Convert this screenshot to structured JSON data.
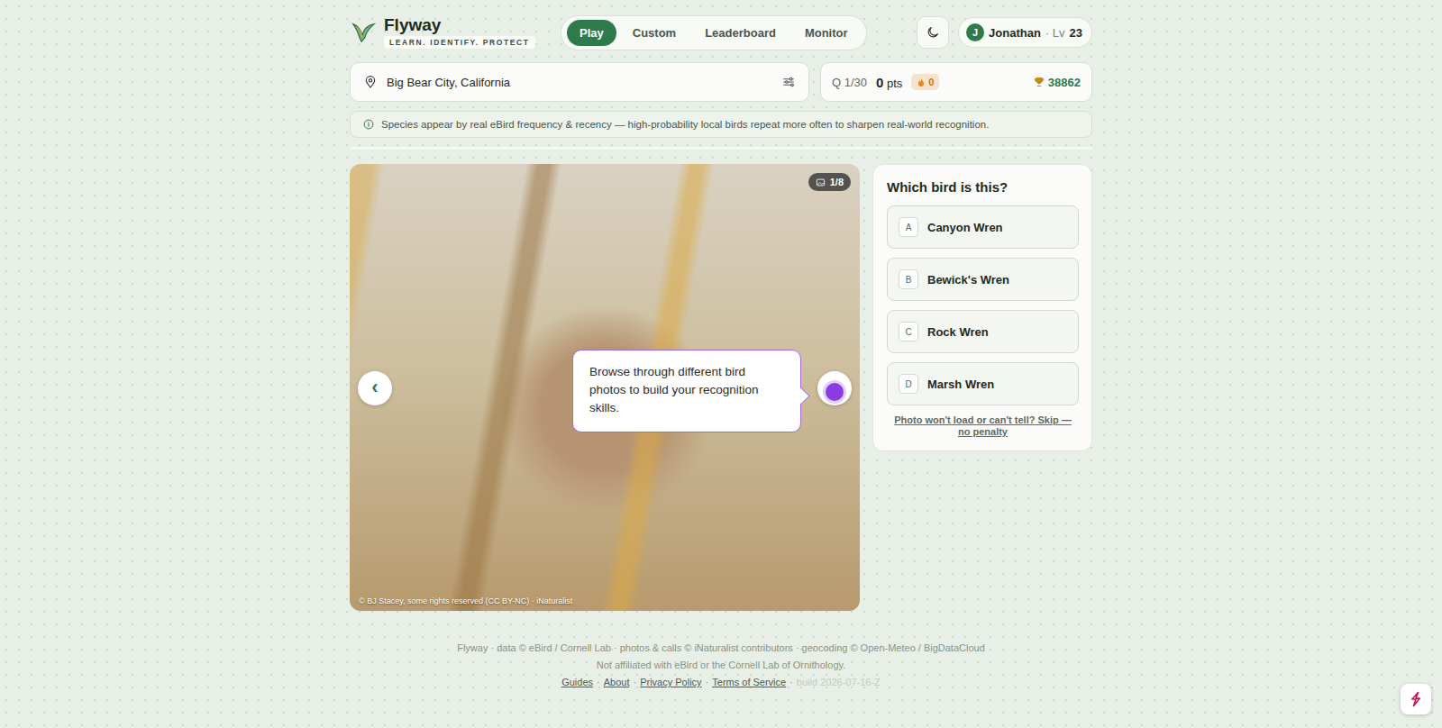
{
  "brand": {
    "name": "Flyway",
    "tagline": "LEARN. IDENTIFY. PROTECT"
  },
  "nav": [
    {
      "label": "Play",
      "selected": true
    },
    {
      "label": "Custom",
      "selected": false
    },
    {
      "label": "Leaderboard",
      "selected": false
    },
    {
      "label": "Monitor",
      "selected": false
    }
  ],
  "user": {
    "initial": "J",
    "name": "Jonathan",
    "level_label": "· Lv",
    "level": "23"
  },
  "location": {
    "value": "Big Bear City, California"
  },
  "stats": {
    "question": "Q 1/30",
    "points": "0",
    "points_unit": "pts",
    "streak": "0",
    "best": "38862"
  },
  "info": "Species appear by real eBird frequency & recency — high-probability local birds repeat more often to sharpen real-world recognition.",
  "photo": {
    "counter": "1/8",
    "credit": "© BJ Stacey, some rights reserved (CC BY-NC) · iNaturalist",
    "prev": "‹"
  },
  "tour_tooltip": "Browse through different bird photos to build your recognition skills.",
  "quiz": {
    "question": "Which bird is this?",
    "options": [
      {
        "letter": "A",
        "name": "Canyon Wren",
        "selected": false
      },
      {
        "letter": "B",
        "name": "Bewick's Wren",
        "selected": false
      },
      {
        "letter": "C",
        "name": "Rock Wren",
        "selected": false
      },
      {
        "letter": "D",
        "name": "Marsh Wren",
        "selected": false
      }
    ],
    "skip": "Photo won't load or can't tell? Skip — no penalty"
  },
  "footer": {
    "credits": "Flyway · data © eBird / Cornell Lab · photos & calls © iNaturalist contributors · geocoding © Open-Meteo / BigDataCloud",
    "disclaimer": "Not affiliated with eBird or the Cornell Lab of Ornithology.",
    "links": [
      "Guides",
      "About",
      "Privacy Policy",
      "Terms of Service"
    ],
    "separator": "·",
    "build": "build 2026-07-16-Z"
  }
}
